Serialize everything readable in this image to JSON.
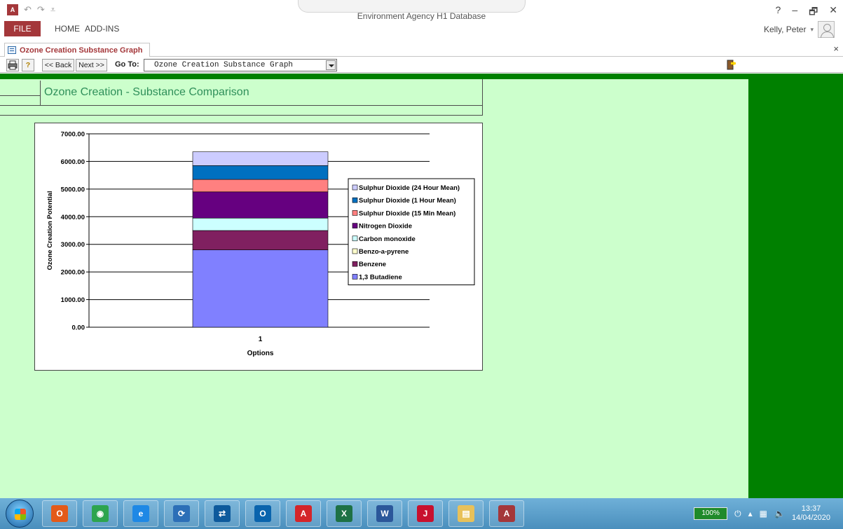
{
  "window": {
    "title": "Environment Agency H1 Database",
    "app_logo": "A",
    "controls": [
      "?",
      "–",
      "🗗",
      "✕"
    ]
  },
  "ribbon": {
    "tabs": [
      "FILE",
      "HOME",
      "ADD-INS"
    ],
    "user_name": "Kelly, Peter",
    "user_caret": "▾"
  },
  "doc_tab": {
    "label": "Ozone Creation Substance Graph",
    "close": "×"
  },
  "toolbar": {
    "back_label": "<< Back",
    "next_label": "Next >>",
    "goto_label": "Go To:",
    "goto_value": "Ozone Creation Substance Graph"
  },
  "form": {
    "title": "Ozone Creation - Substance Comparison"
  },
  "chart_data": {
    "type": "bar",
    "stacked": true,
    "xlabel": "Options",
    "ylabel": "Ozone Creation Potential",
    "categories": [
      "1"
    ],
    "ylim": [
      0,
      7000
    ],
    "yticks": [
      "0.00",
      "1000.00",
      "2000.00",
      "3000.00",
      "4000.00",
      "5000.00",
      "6000.00",
      "7000.00"
    ],
    "grid": true,
    "legend_position": "right",
    "series": [
      {
        "name": "1,3 Butadiene",
        "values": [
          2800
        ],
        "color": "#8080ff"
      },
      {
        "name": "Benzene",
        "values": [
          700
        ],
        "color": "#802060"
      },
      {
        "name": "Benzo-a-pyrene",
        "values": [
          0
        ],
        "color": "#ffffcc"
      },
      {
        "name": "Carbon monoxide",
        "values": [
          450
        ],
        "color": "#ccffff"
      },
      {
        "name": "Nitrogen Dioxide",
        "values": [
          950
        ],
        "color": "#660080"
      },
      {
        "name": "Sulphur Dioxide  (15 Min Mean)",
        "values": [
          450
        ],
        "color": "#ff8080"
      },
      {
        "name": "Sulphur Dioxide (1 Hour Mean)",
        "values": [
          500
        ],
        "color": "#0070c0"
      },
      {
        "name": "Sulphur Dioxide (24 Hour Mean)",
        "values": [
          500
        ],
        "color": "#ccccff"
      }
    ]
  },
  "taskbar": {
    "apps": [
      {
        "name": "office-app",
        "color": "#e35a19",
        "label": "O"
      },
      {
        "name": "chrome-app",
        "color": "#2da44e",
        "label": "◉"
      },
      {
        "name": "internet-explorer-app",
        "color": "#1e88e5",
        "label": "e"
      },
      {
        "name": "sync-app",
        "color": "#2c6fb7",
        "label": "⟳"
      },
      {
        "name": "teamviewer-app",
        "color": "#0e5a9c",
        "label": "⇄"
      },
      {
        "name": "outlook-app",
        "color": "#0a64ad",
        "label": "O"
      },
      {
        "name": "acrobat-app",
        "color": "#d4252a",
        "label": "A"
      },
      {
        "name": "excel-app",
        "color": "#1e7145",
        "label": "X"
      },
      {
        "name": "word-app",
        "color": "#2b579a",
        "label": "W"
      },
      {
        "name": "reader-app",
        "color": "#c8102e",
        "label": "J"
      },
      {
        "name": "explorer-app",
        "color": "#e8c15a",
        "label": "▤"
      },
      {
        "name": "access-app",
        "color": "#a4373a",
        "label": "A"
      }
    ],
    "battery": "100%",
    "time": "13:37",
    "date": "14/04/2020"
  }
}
